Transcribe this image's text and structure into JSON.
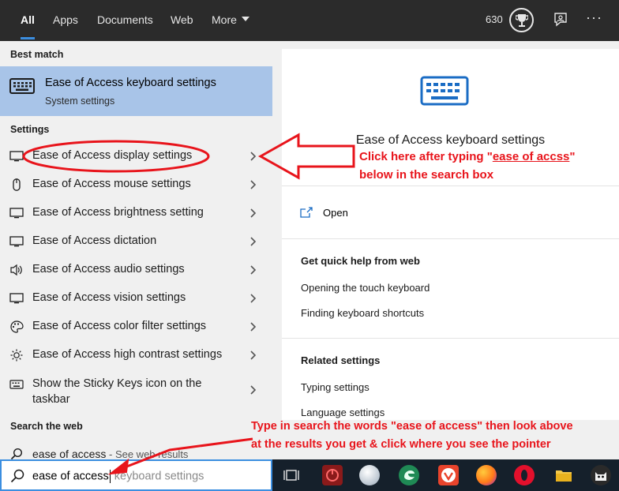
{
  "top_tabs": [
    "All",
    "Apps",
    "Documents",
    "Web",
    "More"
  ],
  "score": "630",
  "sections": {
    "best_match": "Best match",
    "settings": "Settings",
    "search_web": "Search the web"
  },
  "best_match": {
    "title": "Ease of Access keyboard settings",
    "subtitle": "System settings"
  },
  "settings_items": [
    {
      "prefix": "Ease of Access",
      "suffix": " display settings",
      "icon": "monitor-icon"
    },
    {
      "prefix": "Ease of Access",
      "suffix": " mouse settings",
      "icon": "mouse-icon"
    },
    {
      "prefix": "Ease of Access",
      "suffix": " brightness setting",
      "icon": "monitor-icon"
    },
    {
      "prefix": "Ease of Access",
      "suffix": " dictation",
      "icon": "monitor-icon"
    },
    {
      "prefix": "Ease of Access",
      "suffix": " audio settings",
      "icon": "speaker-icon"
    },
    {
      "prefix": "Ease of Access",
      "suffix": " vision settings",
      "icon": "monitor-icon"
    },
    {
      "prefix": "Ease of Access",
      "suffix": " color filter settings",
      "icon": "palette-icon"
    },
    {
      "prefix": "Ease of Access",
      "suffix": " high contrast settings",
      "icon": "brightness-icon"
    },
    {
      "prefix": "",
      "suffix": "Show the Sticky Keys icon on the taskbar",
      "icon": "keyboard-icon"
    }
  ],
  "web_result": {
    "text": "ease of access",
    "sub": " - See web results"
  },
  "preview": {
    "title": "Ease of Access keyboard settings",
    "open": "Open",
    "quick_help_heading": "Get quick help from web",
    "quick_help_links": [
      "Opening the touch keyboard",
      "Finding keyboard shortcuts"
    ],
    "related_heading": "Related settings",
    "related_links": [
      "Typing settings",
      "Language settings"
    ]
  },
  "search": {
    "typed": "ease of access",
    "suggestion": " keyboard settings"
  },
  "annotations": {
    "top_line1_prefix": "Click here after typing \"",
    "top_line1_link": "ease of accss",
    "top_line1_suffix": "\"",
    "top_line2": "below in the search box",
    "bottom_line1": "Type in search the words \"ease of access\" then look above",
    "bottom_line2": "at the results you get & click where you see the pointer"
  },
  "colors": {
    "accent": "#3b8ee0",
    "highlight": "#a8c4e8",
    "annotation": "#e8141b",
    "topbar": "#2b2b2b",
    "taskbar": "#15202b"
  }
}
